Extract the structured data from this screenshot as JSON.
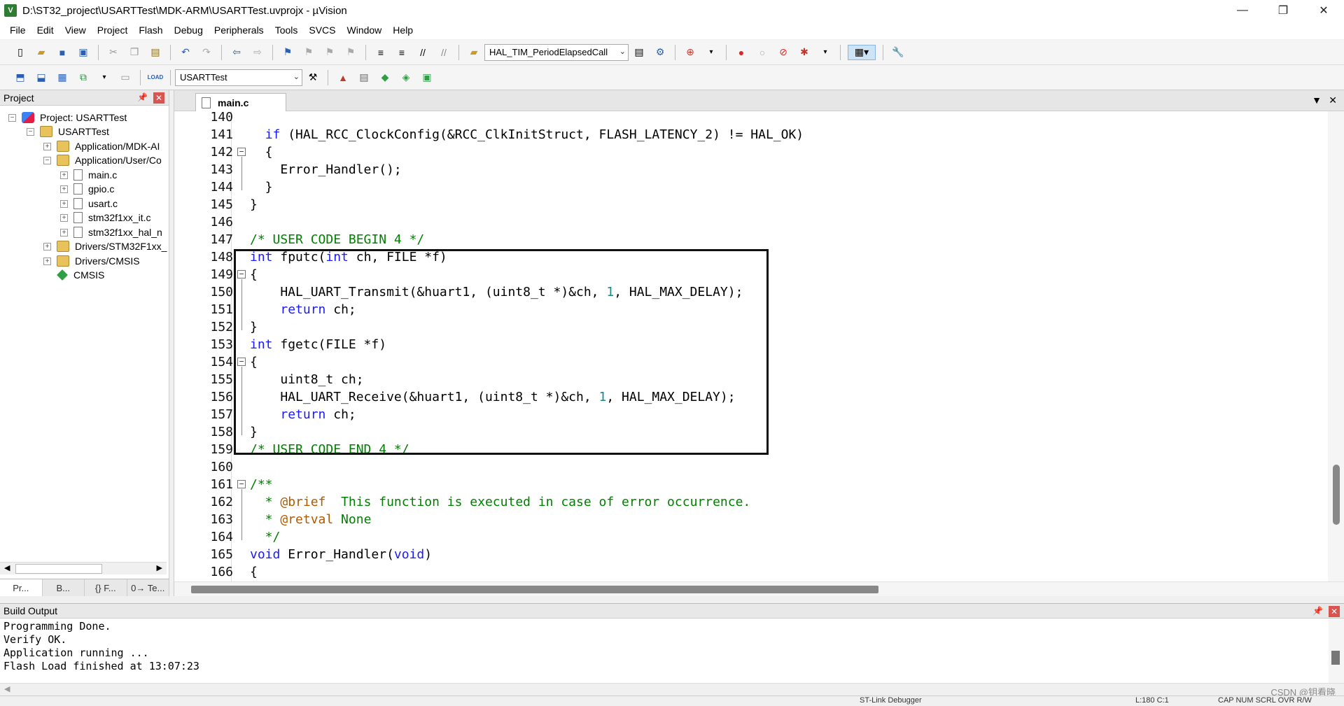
{
  "window": {
    "title": "D:\\ST32_project\\USARTTest\\MDK-ARM\\USARTTest.uvprojx - µVision",
    "controls": [
      "—",
      "❐",
      "✕"
    ]
  },
  "menu": [
    "File",
    "Edit",
    "View",
    "Project",
    "Flash",
    "Debug",
    "Peripherals",
    "Tools",
    "SVCS",
    "Window",
    "Help"
  ],
  "toolbar": {
    "function_combo": "HAL_TIM_PeriodElapsedCall",
    "target_combo": "USARTTest",
    "load_label": "LOAD"
  },
  "project_panel": {
    "title": "Project",
    "root": "Project: USARTTest",
    "target": "USARTTest",
    "groups": [
      {
        "label": "Application/MDK-AI"
      },
      {
        "label": "Application/User/Co"
      },
      {
        "label": "main.c"
      },
      {
        "label": "gpio.c"
      },
      {
        "label": "usart.c"
      },
      {
        "label": "stm32f1xx_it.c"
      },
      {
        "label": "stm32f1xx_hal_n"
      },
      {
        "label": "Drivers/STM32F1xx_"
      },
      {
        "label": "Drivers/CMSIS"
      },
      {
        "label": "CMSIS"
      }
    ],
    "tabs": [
      "Pr...",
      "B...",
      "{} F...",
      "0→ Te..."
    ]
  },
  "editor": {
    "active_tab": "main.c"
  },
  "code_lines": [
    {
      "n": "140",
      "t": ""
    },
    {
      "n": "141",
      "t": "  if (HAL_RCC_ClockConfig(&RCC_ClkInitStruct, FLASH_LATENCY_2) != HAL_OK)"
    },
    {
      "n": "142",
      "t": "  {"
    },
    {
      "n": "143",
      "t": "    Error_Handler();"
    },
    {
      "n": "144",
      "t": "  }"
    },
    {
      "n": "145",
      "t": "}"
    },
    {
      "n": "146",
      "t": ""
    },
    {
      "n": "147",
      "t": "/* USER CODE BEGIN 4 */"
    },
    {
      "n": "148",
      "t": "int fputc(int ch, FILE *f)"
    },
    {
      "n": "149",
      "t": "{"
    },
    {
      "n": "150",
      "t": "    HAL_UART_Transmit(&huart1, (uint8_t *)&ch, 1, HAL_MAX_DELAY);"
    },
    {
      "n": "151",
      "t": "    return ch;"
    },
    {
      "n": "152",
      "t": "}"
    },
    {
      "n": "153",
      "t": "int fgetc(FILE *f)"
    },
    {
      "n": "154",
      "t": "{"
    },
    {
      "n": "155",
      "t": "    uint8_t ch;"
    },
    {
      "n": "156",
      "t": "    HAL_UART_Receive(&huart1, (uint8_t *)&ch, 1, HAL_MAX_DELAY);"
    },
    {
      "n": "157",
      "t": "    return ch;"
    },
    {
      "n": "158",
      "t": "}"
    },
    {
      "n": "159",
      "t": "/* USER CODE END 4 */"
    },
    {
      "n": "160",
      "t": ""
    },
    {
      "n": "161",
      "t": "/**"
    },
    {
      "n": "162",
      "t": "  * @brief  This function is executed in case of error occurrence."
    },
    {
      "n": "163",
      "t": "  * @retval None"
    },
    {
      "n": "164",
      "t": "  */"
    },
    {
      "n": "165",
      "t": "void Error_Handler(void)"
    },
    {
      "n": "166",
      "t": "{"
    }
  ],
  "build_output": {
    "title": "Build Output",
    "text": "Programming Done.\nVerify OK.\nApplication running ...\nFlash Load finished at 13:07:23"
  },
  "statusbar": {
    "debugger": "ST-Link Debugger",
    "position": "L:180 C:1",
    "flags": "CAP  NUM  SCRL  OVR  R/W"
  },
  "watermark": "CSDN @钥看晓"
}
